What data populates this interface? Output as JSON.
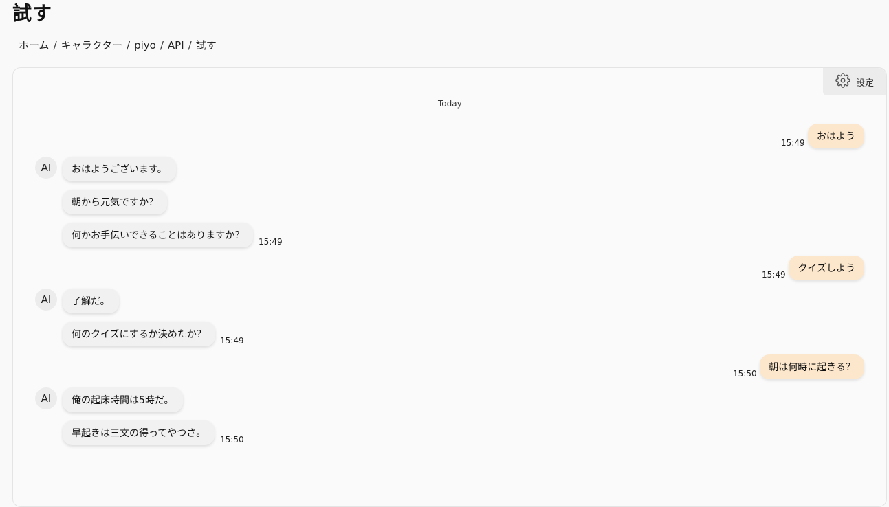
{
  "page": {
    "title": "試す"
  },
  "breadcrumb": [
    "ホーム",
    "キャラクター",
    "piyo",
    "API",
    "試す"
  ],
  "settings": {
    "label": "設定",
    "icon": "gear-icon"
  },
  "divider": {
    "label": "Today"
  },
  "avatar_label": "AI",
  "messages": [
    {
      "role": "user",
      "text": "おはよう",
      "time": "15:49"
    },
    {
      "role": "ai",
      "texts": [
        "おはようございます。",
        "朝から元気ですか？",
        "何かお手伝いできることはありますか？"
      ],
      "time": "15:49"
    },
    {
      "role": "user",
      "text": "クイズしよう",
      "time": "15:49"
    },
    {
      "role": "ai",
      "texts": [
        "了解だ。",
        "何のクイズにするか決めたか？"
      ],
      "time": "15:49"
    },
    {
      "role": "user",
      "text": "朝は何時に起きる？",
      "time": "15:50"
    },
    {
      "role": "ai",
      "texts": [
        "俺の起床時間は5時だ。",
        "早起きは三文の得ってやつさ。"
      ],
      "time": "15:50"
    }
  ],
  "colors": {
    "user_bubble": "#fce7cc",
    "ai_bubble": "#f1f1f2",
    "background": "#f9f9f9"
  }
}
